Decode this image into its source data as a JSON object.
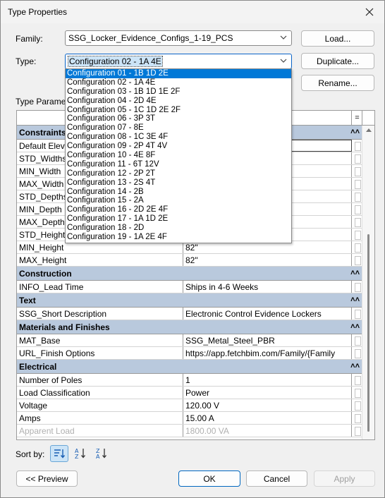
{
  "window": {
    "title": "Type Properties"
  },
  "family": {
    "label": "Family:",
    "value": "SSG_Locker_Evidence_Configs_1-19_PCS"
  },
  "type": {
    "label": "Type:",
    "value": "Configuration 02 - 1A 4E"
  },
  "buttons": {
    "load": "Load...",
    "duplicate": "Duplicate...",
    "rename": "Rename..."
  },
  "type_parameters_label": "Type Parameters",
  "dropdown_options": [
    "Configuration 01 - 1B 1D 2E",
    "Configuration 02 - 1A 4E",
    "Configuration 03 - 1B 1D 1E 2F",
    "Configuration 04 - 2D 4E",
    "Configuration 05 - 1C 1D 2E 2F",
    "Configuration 06 - 3P 3T",
    "Configuration 07 - 8E",
    "Configuration 08 - 1C 3E 4F",
    "Configuration 09 - 2P 4T 4V",
    "Configuration 10 - 4E 8F",
    "Configuration 11 - 6T 12V",
    "Configuration 12 - 2P 2T",
    "Configuration 13 - 2S 4T",
    "Configuration 14 - 2B",
    "Configuration 15 - 2A",
    "Configuration 16 - 2D 2E 4F",
    "Configuration 17 - 1A 1D 2E",
    "Configuration 18 - 2D",
    "Configuration 19 - 1A 2E 4F"
  ],
  "grid": {
    "header_col3": "=",
    "sections": [
      {
        "title": "Constraints",
        "rows": [
          {
            "name": "Default Elevation",
            "value": ""
          },
          {
            "name": "STD_Widths",
            "value": ""
          },
          {
            "name": "MIN_Width",
            "value": ""
          },
          {
            "name": "MAX_Width",
            "value": ""
          },
          {
            "name": "STD_Depths",
            "value": ""
          },
          {
            "name": "MIN_Depth",
            "value": ""
          },
          {
            "name": "MAX_Depth",
            "value": ""
          },
          {
            "name": "STD_Heights",
            "value": ""
          },
          {
            "name": "MIN_Height",
            "value": "82\""
          },
          {
            "name": "MAX_Height",
            "value": "82\""
          }
        ]
      },
      {
        "title": "Construction",
        "rows": [
          {
            "name": "INFO_Lead Time",
            "value": "Ships in 4-6 Weeks"
          }
        ]
      },
      {
        "title": "Text",
        "rows": [
          {
            "name": "SSG_Short Description",
            "value": "Electronic Control Evidence Lockers"
          }
        ]
      },
      {
        "title": "Materials and Finishes",
        "rows": [
          {
            "name": "MAT_Base",
            "value": "SSG_Metal_Steel_PBR"
          },
          {
            "name": "URL_Finish Options",
            "value": "https://app.fetchbim.com/Family/{Family"
          }
        ]
      },
      {
        "title": "Electrical",
        "rows": [
          {
            "name": "Number of Poles",
            "value": "1"
          },
          {
            "name": "Load Classification",
            "value": "Power"
          },
          {
            "name": "Voltage",
            "value": "120.00 V"
          },
          {
            "name": "Amps",
            "value": "15.00 A"
          },
          {
            "name": "Apparent Load",
            "value": "1800.00 VA"
          }
        ]
      }
    ]
  },
  "sort": {
    "label": "Sort by:"
  },
  "footer": {
    "preview": "<< Preview",
    "ok": "OK",
    "cancel": "Cancel",
    "apply": "Apply"
  }
}
